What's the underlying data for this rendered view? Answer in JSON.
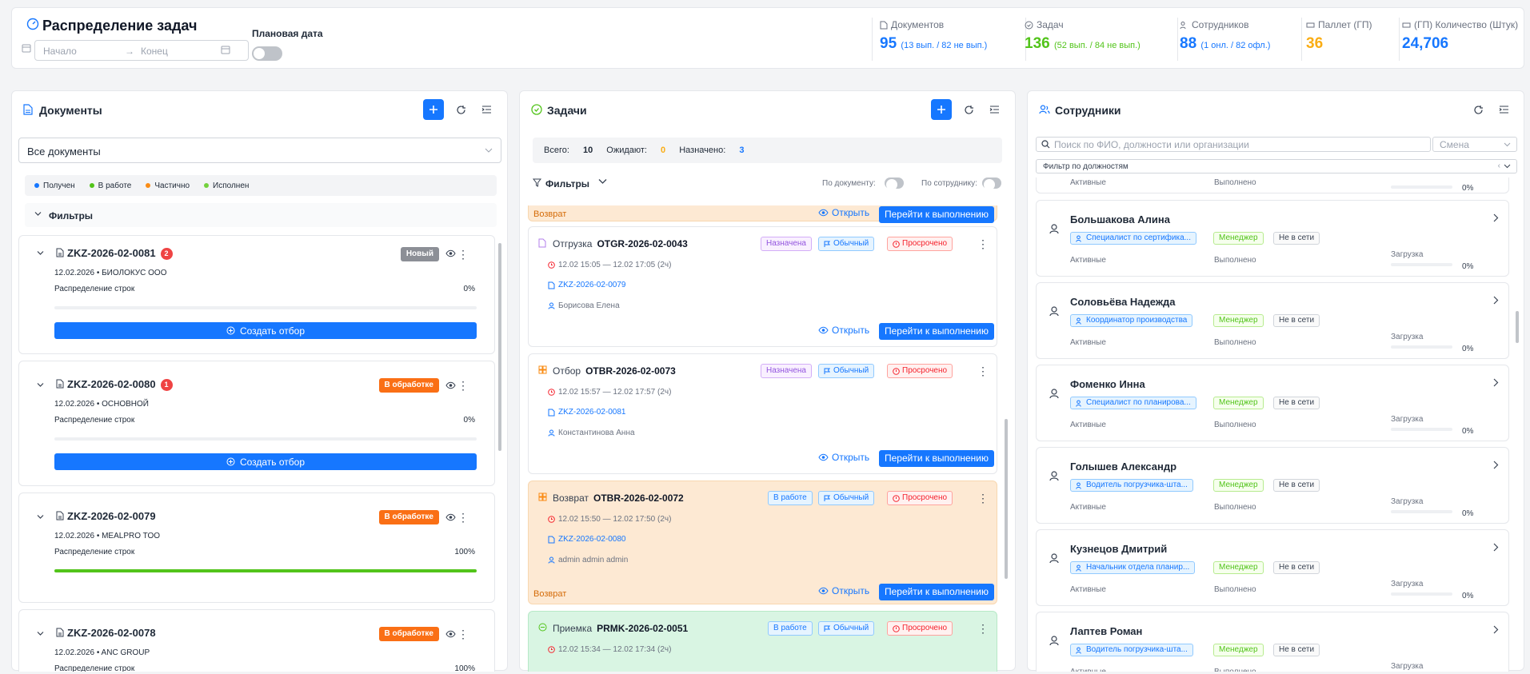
{
  "header": {
    "title": "Распределение задач",
    "range_start_placeholder": "Начало",
    "range_arrow": "→",
    "range_end_placeholder": "Конец",
    "plan_date_label": "Плановая дата",
    "plan_date_enabled": false,
    "stats": [
      {
        "label": "Документов",
        "value": "95",
        "detail": "(13 вып. / 82 не вып.)",
        "color": "#1677ff"
      },
      {
        "label": "Задач",
        "value": "136",
        "detail": "(52 вып. / 84 не вып.)",
        "color": "#52c41a"
      },
      {
        "label": "Сотрудников",
        "value": "88",
        "detail": "(1 онл. / 82 офл.)",
        "color": "#1677ff"
      },
      {
        "label": "Паллет (ГП)",
        "value": "36",
        "detail": "",
        "color": "#faad14"
      },
      {
        "label": "(ГП) Количество (Штук)",
        "value": "24,706",
        "detail": "",
        "color": "#1677ff"
      }
    ]
  },
  "documents": {
    "title": "Документы",
    "filter_select": "Все документы",
    "legend": [
      {
        "label": "Получен",
        "color": "#1677ff"
      },
      {
        "label": "В работе",
        "color": "#52c41a"
      },
      {
        "label": "Частично",
        "color": "#fa8c16"
      },
      {
        "label": "Исполнен",
        "color": "#73d13d"
      }
    ],
    "filters_label": "Фильтры",
    "distribution_label": "Распределение строк",
    "create_label": "Создать отбор",
    "items": [
      {
        "number": "ZKZ-2026-02-0081",
        "count": "2",
        "status": "Новый",
        "status_color": "#8c8f96",
        "meta": "12.02.2026 • БИОЛОКУС ООО",
        "percent": "0%",
        "progress": 0,
        "show_create": true
      },
      {
        "number": "ZKZ-2026-02-0080",
        "count": "1",
        "status": "В обработке",
        "status_color": "#fa6f15",
        "meta": "12.02.2026 • ОСНОВНОЙ",
        "percent": "0%",
        "progress": 0,
        "show_create": true
      },
      {
        "number": "ZKZ-2026-02-0079",
        "count": "",
        "status": "В обработке",
        "status_color": "#fa6f15",
        "meta": "12.02.2026 • MEALPRO TOO",
        "percent": "100%",
        "progress": 1,
        "show_create": false
      },
      {
        "number": "ZKZ-2026-02-0078",
        "count": "",
        "status": "В обработке",
        "status_color": "#fa6f15",
        "meta": "12.02.2026 • ANC GROUP",
        "percent": "100%",
        "progress": 1,
        "show_create": false
      }
    ]
  },
  "tasks": {
    "title": "Задачи",
    "summary": {
      "total_label": "Всего:",
      "total": "10",
      "waiting_label": "Ожидают:",
      "waiting": "0",
      "assigned_label": "Назначено:",
      "assigned": "3"
    },
    "filters_label": "Фильтры",
    "by_document_label": "По документу:",
    "by_employee_label": "По сотруднику:",
    "open_label": "Открыть",
    "go_label": "Перейти к выполнению",
    "return_label": "Возврат",
    "items": [
      {
        "type": "Отгрузка",
        "number": "OTGR-2026-02-0043",
        "state": "Назначена",
        "priority": "Обычный",
        "overdue": "Просрочено",
        "time": "12.02 15:05 — 12.02 17:05 (2ч)",
        "doc": "ZKZ-2026-02-0079",
        "user": "Борисова Елена",
        "variant": "white"
      },
      {
        "type": "Отбор",
        "number": "OTBR-2026-02-0073",
        "state": "Назначена",
        "priority": "Обычный",
        "overdue": "Просрочено",
        "time": "12.02 15:57 — 12.02 17:57 (2ч)",
        "doc": "ZKZ-2026-02-0081",
        "user": "Константинова Анна",
        "variant": "white"
      },
      {
        "type": "Возврат",
        "number": "OTBR-2026-02-0072",
        "state": "В работе",
        "priority": "Обычный",
        "overdue": "Просрочено",
        "time": "12.02 15:50 — 12.02 17:50 (2ч)",
        "doc": "ZKZ-2026-02-0080",
        "user": "admin admin admin",
        "variant": "orange"
      },
      {
        "type": "Приемка",
        "number": "PRMK-2026-02-0051",
        "state": "В работе",
        "priority": "Обычный",
        "overdue": "Просрочено",
        "time": "12.02 15:34 — 12.02 17:34 (2ч)",
        "doc": "",
        "user": "",
        "variant": "green"
      }
    ]
  },
  "staff": {
    "title": "Сотрудники",
    "search_placeholder": "Поиск по ФИО, должности или организации",
    "shift_placeholder": "Смена",
    "position_filter": "Фильтр по должностям",
    "active_label": "Активные",
    "done_label": "Выполнено",
    "load_label": "Загрузка",
    "first_pct": "0%",
    "items": [
      {
        "name": "Большакова Алина",
        "position": "Специалист по сертифика...",
        "role": "Менеджер",
        "online": "Не в сети",
        "load": "0%"
      },
      {
        "name": "Соловьёва Надежда",
        "position": "Координатор производства",
        "role": "Менеджер",
        "online": "Не в сети",
        "load": "0%"
      },
      {
        "name": "Фоменко Инна",
        "position": "Специалист по планирова...",
        "role": "Менеджер",
        "online": "Не в сети",
        "load": "0%"
      },
      {
        "name": "Голышев Александр",
        "position": "Водитель погрузчика-шта...",
        "role": "Менеджер",
        "online": "Не в сети",
        "load": "0%"
      },
      {
        "name": "Кузнецов Дмитрий",
        "position": "Начальник отдела планир...",
        "role": "Менеджер",
        "online": "Не в сети",
        "load": "0%"
      },
      {
        "name": "Лаптев Роман",
        "position": "Водитель погрузчика-шта...",
        "role": "Менеджер",
        "online": "Не в сети",
        "load": "0%"
      }
    ]
  }
}
